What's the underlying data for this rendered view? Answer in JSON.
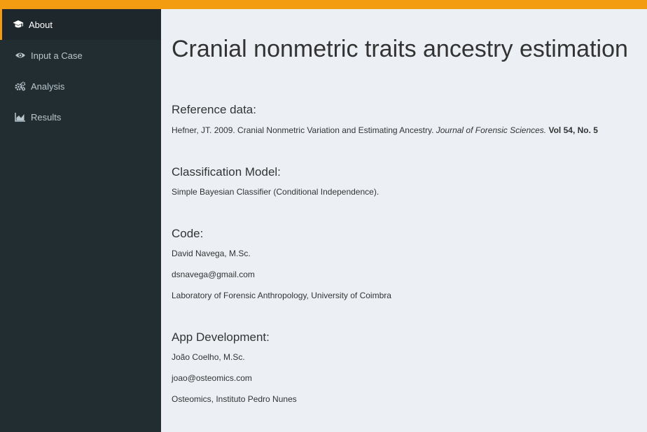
{
  "colors": {
    "accent": "#f39c12",
    "sidebar_bg": "#222d32",
    "sidebar_active_bg": "#1e282c",
    "content_bg": "#ecf0f5"
  },
  "sidebar": {
    "items": [
      {
        "label": "About",
        "icon": "graduation-cap-icon",
        "active": true
      },
      {
        "label": "Input a Case",
        "icon": "eye-icon",
        "active": false
      },
      {
        "label": "Analysis",
        "icon": "gears-icon",
        "active": false
      },
      {
        "label": "Results",
        "icon": "area-chart-icon",
        "active": false
      }
    ]
  },
  "main": {
    "title": "Cranial nonmetric traits ancestry estimation",
    "reference": {
      "heading": "Reference data:",
      "citation_plain": "Hefner, JT. 2009. Cranial Nonmetric Variation and Estimating Ancestry. ",
      "citation_journal": "Journal of Forensic Sciences.",
      "citation_volume": "Vol 54, No. 5"
    },
    "model": {
      "heading": "Classification Model:",
      "text": "Simple Bayesian Classifier (Conditional Independence)."
    },
    "code": {
      "heading": "Code:",
      "name": "David Navega, M.Sc.",
      "email": "dsnavega@gmail.com",
      "affiliation": "Laboratory of Forensic Anthropology, University of Coimbra"
    },
    "app_dev": {
      "heading": "App Development:",
      "name": "João Coelho, M.Sc.",
      "email": "joao@osteomics.com",
      "affiliation": "Osteomics, Instituto Pedro Nunes"
    }
  }
}
